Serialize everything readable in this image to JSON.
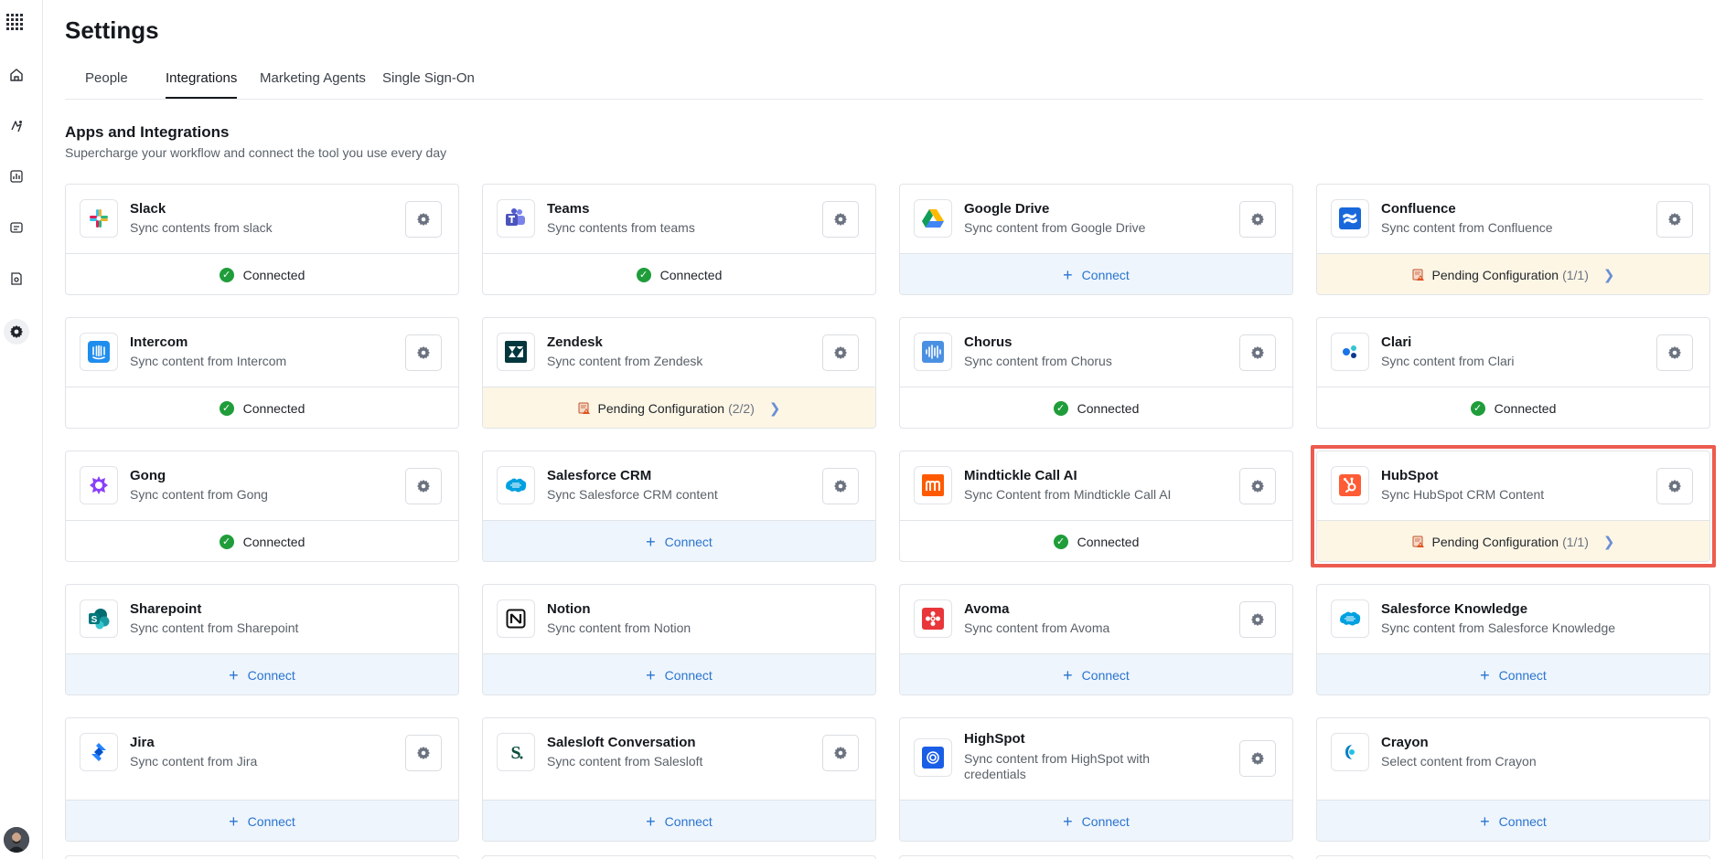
{
  "app": {
    "title": "Settings",
    "avatar": "user-avatar"
  },
  "rail": {
    "items": [
      {
        "icon": "home-icon"
      },
      {
        "icon": "agent-icon"
      },
      {
        "icon": "analytics-icon"
      },
      {
        "icon": "content-icon"
      },
      {
        "icon": "library-icon"
      },
      {
        "icon": "gear-icon",
        "active": true
      }
    ]
  },
  "tabs": [
    {
      "label": "People"
    },
    {
      "label": "Integrations",
      "active": true
    },
    {
      "label": "Marketing Agents"
    },
    {
      "label": "Single Sign-On"
    }
  ],
  "section": {
    "title": "Apps and Integrations",
    "subtitle": "Supercharge your workflow and connect the tool you use every day"
  },
  "status_labels": {
    "connected": "Connected",
    "connect": "Connect",
    "pending": "Pending Configuration"
  },
  "colors": {
    "connected_green": "#1f9d3a",
    "connect_blue": "#2a74d0",
    "pending_bg": "#fdf6e5",
    "highlight_red": "#ec5b4f"
  },
  "integrations": [
    {
      "name": "Slack",
      "desc": "Sync contents from slack",
      "status": "connected",
      "icon": "slack-icon"
    },
    {
      "name": "Teams",
      "desc": "Sync contents from teams",
      "status": "connected",
      "icon": "teams-icon"
    },
    {
      "name": "Google Drive",
      "desc": "Sync content from Google Drive",
      "status": "connect",
      "icon": "google-drive-icon"
    },
    {
      "name": "Confluence",
      "desc": "Sync content from Confluence",
      "status": "pending",
      "pending_count": "(1/1)",
      "icon": "confluence-icon"
    },
    {
      "name": "Intercom",
      "desc": "Sync content from Intercom",
      "status": "connected",
      "icon": "intercom-icon"
    },
    {
      "name": "Zendesk",
      "desc": "Sync content from Zendesk",
      "status": "pending",
      "pending_count": "(2/2)",
      "icon": "zendesk-icon"
    },
    {
      "name": "Chorus",
      "desc": "Sync content from Chorus",
      "status": "connected",
      "icon": "chorus-icon"
    },
    {
      "name": "Clari",
      "desc": "Sync content from Clari",
      "status": "connected",
      "icon": "clari-icon"
    },
    {
      "name": "Gong",
      "desc": "Sync content from Gong",
      "status": "connected",
      "icon": "gong-icon"
    },
    {
      "name": "Salesforce CRM",
      "desc": "Sync Salesforce CRM content",
      "status": "connect",
      "icon": "salesforce-icon"
    },
    {
      "name": "Mindtickle Call AI",
      "desc": "Sync Content from Mindtickle Call AI",
      "status": "connected",
      "icon": "mindtickle-icon"
    },
    {
      "name": "HubSpot",
      "desc": "Sync HubSpot CRM Content",
      "status": "pending",
      "pending_count": "(1/1)",
      "icon": "hubspot-icon",
      "highlighted": true
    },
    {
      "name": "Sharepoint",
      "desc": "Sync content from Sharepoint",
      "status": "connect",
      "icon": "sharepoint-icon",
      "no_gear": true
    },
    {
      "name": "Notion",
      "desc": "Sync content from Notion",
      "status": "connect",
      "icon": "notion-icon",
      "no_gear": true
    },
    {
      "name": "Avoma",
      "desc": "Sync content from Avoma",
      "status": "connect",
      "icon": "avoma-icon"
    },
    {
      "name": "Salesforce Knowledge",
      "desc": "Sync content from Salesforce Knowledge",
      "status": "connect",
      "icon": "salesforce-icon",
      "no_gear": true
    },
    {
      "name": "Jira",
      "desc": "Sync content from Jira",
      "status": "connect",
      "icon": "jira-icon"
    },
    {
      "name": "Salesloft Conversation",
      "desc": "Sync content from Salesloft",
      "status": "connect",
      "icon": "salesloft-icon"
    },
    {
      "name": "HighSpot",
      "desc": "Sync content from HighSpot with credentials",
      "status": "connect",
      "icon": "highspot-icon"
    },
    {
      "name": "Crayon",
      "desc": "Select content from Crayon",
      "status": "connect",
      "icon": "crayon-icon",
      "no_gear": true
    }
  ]
}
